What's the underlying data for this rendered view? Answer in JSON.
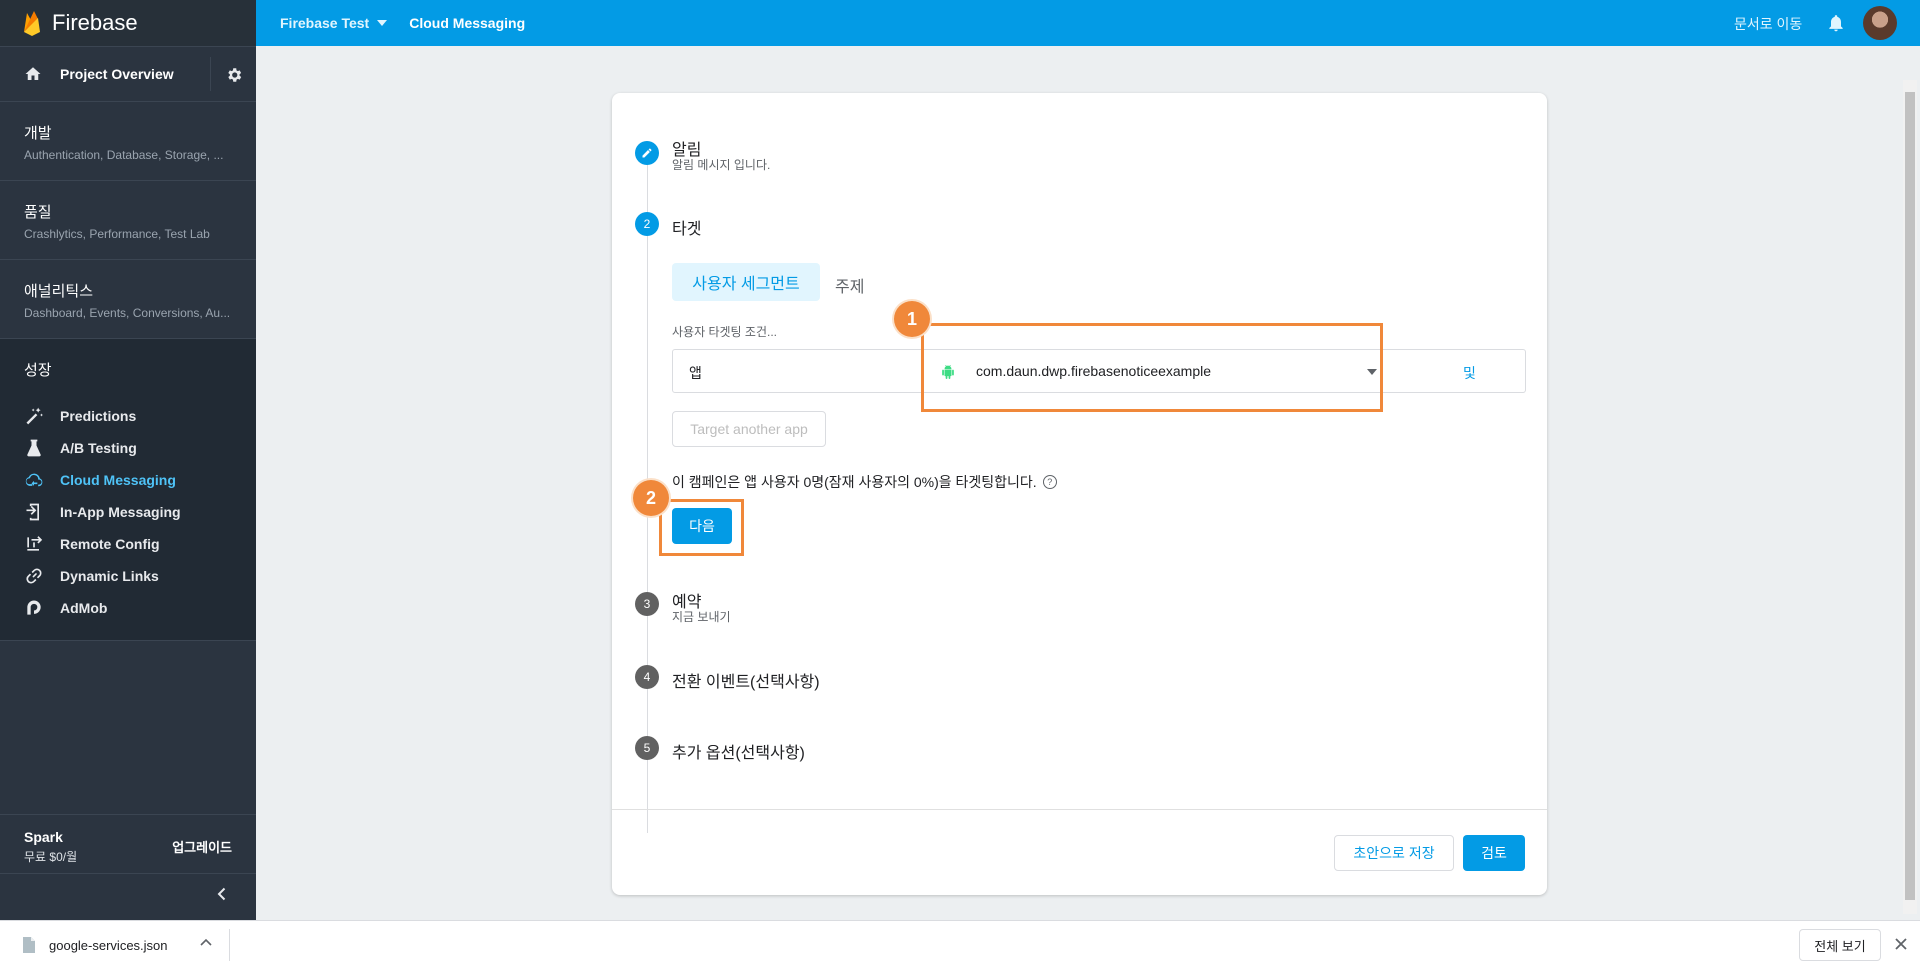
{
  "sidebar": {
    "brand": "Firebase",
    "project_overview": "Project Overview",
    "sections": [
      {
        "title": "개발",
        "subtitle": "Authentication, Database, Storage, ..."
      },
      {
        "title": "품질",
        "subtitle": "Crashlytics, Performance, Test Lab"
      },
      {
        "title": "애널리틱스",
        "subtitle": "Dashboard, Events, Conversions, Au..."
      }
    ],
    "grow": {
      "title": "성장",
      "items": [
        {
          "label": "Predictions",
          "icon": "magic-wand-icon"
        },
        {
          "label": "A/B Testing",
          "icon": "flask-icon"
        },
        {
          "label": "Cloud Messaging",
          "icon": "cloud-sync-icon",
          "active": true
        },
        {
          "label": "In-App Messaging",
          "icon": "in-app-message-icon"
        },
        {
          "label": "Remote Config",
          "icon": "remote-config-icon"
        },
        {
          "label": "Dynamic Links",
          "icon": "link-icon"
        },
        {
          "label": "AdMob",
          "icon": "admob-icon"
        }
      ]
    },
    "plan": {
      "name": "Spark",
      "price": "무료 $0/월",
      "upgrade": "업그레이드"
    }
  },
  "topbar": {
    "project": "Firebase Test",
    "page": "Cloud Messaging",
    "docs": "문서로 이동"
  },
  "steps": {
    "step1": {
      "title": "알림",
      "subtitle": "알림 메시지 입니다."
    },
    "step2": {
      "number": "2",
      "title": "타겟"
    },
    "step3": {
      "number": "3",
      "title": "예약",
      "subtitle": "지금 보내기"
    },
    "step4": {
      "number": "4",
      "title": "전환 이벤트(선택사항)"
    },
    "step5": {
      "number": "5",
      "title": "추가 옵션(선택사항)"
    }
  },
  "target": {
    "tab_segment": "사용자 세그먼트",
    "tab_topic": "주제",
    "condition_label": "사용자 타겟팅 조건...",
    "condition_field": "앱",
    "app_package": "com.daun.dwp.firebasenoticeexample",
    "and_label": "및",
    "another_app": "Target another app",
    "campaign_text": "이 캠페인은 앱 사용자 0명(잠재 사용자의 0%)을 타겟팅합니다.",
    "help": "?",
    "next": "다음"
  },
  "footer": {
    "save_draft": "초안으로 저장",
    "review": "검토"
  },
  "annotations": {
    "badge1": "1",
    "badge2": "2"
  },
  "download_bar": {
    "filename": "google-services.json",
    "view_all": "전체 보기"
  },
  "colors": {
    "accent": "#039be5",
    "sidebar": "#2b3440",
    "highlight": "#f0883a"
  }
}
